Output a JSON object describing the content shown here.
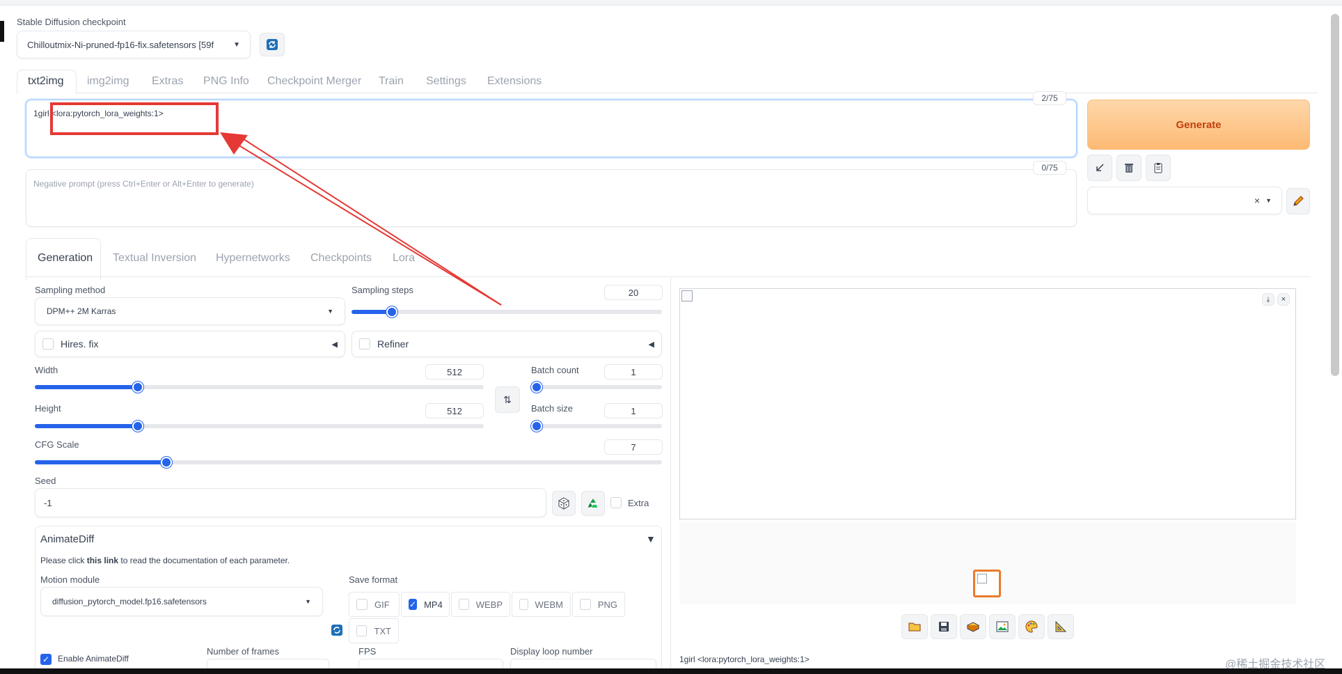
{
  "checkpoint": {
    "label": "Stable Diffusion checkpoint",
    "value": "Chilloutmix-Ni-pruned-fp16-fix.safetensors [59f"
  },
  "main_tabs": [
    {
      "label": "txt2img",
      "active": true
    },
    {
      "label": "img2img"
    },
    {
      "label": "Extras"
    },
    {
      "label": "PNG Info"
    },
    {
      "label": "Checkpoint Merger"
    },
    {
      "label": "Train"
    },
    {
      "label": "Settings"
    },
    {
      "label": "Extensions"
    }
  ],
  "prompt": {
    "text": "1girl <lora:pytorch_lora_weights:1>",
    "counter": "2/75"
  },
  "negative_prompt": {
    "placeholder": "Negative prompt (press Ctrl+Enter or Alt+Enter to generate)",
    "counter": "0/75"
  },
  "generate_label": "Generate",
  "style_clear": "×",
  "sub_tabs": [
    {
      "label": "Generation",
      "active": true
    },
    {
      "label": "Textual Inversion"
    },
    {
      "label": "Hypernetworks"
    },
    {
      "label": "Checkpoints"
    },
    {
      "label": "Lora"
    }
  ],
  "sampling_method": {
    "label": "Sampling method",
    "value": "DPM++ 2M Karras"
  },
  "sampling_steps": {
    "label": "Sampling steps",
    "value": "20",
    "fraction": 0.13
  },
  "hires_fix": {
    "label": "Hires. fix"
  },
  "refiner": {
    "label": "Refiner"
  },
  "width": {
    "label": "Width",
    "value": "512",
    "fraction": 0.23
  },
  "height": {
    "label": "Height",
    "value": "512",
    "fraction": 0.23
  },
  "batch_count": {
    "label": "Batch count",
    "value": "1",
    "fraction": 0.0
  },
  "batch_size": {
    "label": "Batch size",
    "value": "1",
    "fraction": 0.0
  },
  "cfg_scale": {
    "label": "CFG Scale",
    "value": "7",
    "fraction": 0.21
  },
  "seed": {
    "label": "Seed",
    "value": "-1",
    "extra_label": "Extra"
  },
  "animatediff": {
    "title": "AnimateDiff",
    "doc_prefix": "Please click ",
    "doc_link": "this link",
    "doc_suffix": " to read the documentation of each parameter.",
    "motion_module_label": "Motion module",
    "motion_module_value": "diffusion_pytorch_model.fp16.safetensors",
    "save_format_label": "Save format",
    "formats": [
      {
        "label": "GIF",
        "checked": false
      },
      {
        "label": "MP4",
        "checked": true
      },
      {
        "label": "WEBP",
        "checked": false
      },
      {
        "label": "WEBM",
        "checked": false
      },
      {
        "label": "PNG",
        "checked": false
      },
      {
        "label": "TXT",
        "checked": false
      }
    ],
    "enable_label": "Enable AnimateDiff",
    "frames_label": "Number of frames",
    "fps_label": "FPS",
    "loop_label": "Display loop number"
  },
  "output": {
    "caption": "1girl <lora:pytorch_lora_weights:1>"
  },
  "watermark": "@稀土掘金技术社区",
  "colors": {
    "accent": "#2563eb",
    "generate_bg": "#fdba74",
    "generate_text": "#c2410c",
    "annotation": "#e53935"
  },
  "icons": {
    "refresh": "refresh-icon",
    "tools": [
      "arrow-icon",
      "trash-icon",
      "clipboard-icon",
      "pencil-icon"
    ],
    "output_tools": [
      "folder-icon",
      "save-icon",
      "zip-icon",
      "image-icon",
      "palette-icon",
      "ruler-icon"
    ]
  }
}
